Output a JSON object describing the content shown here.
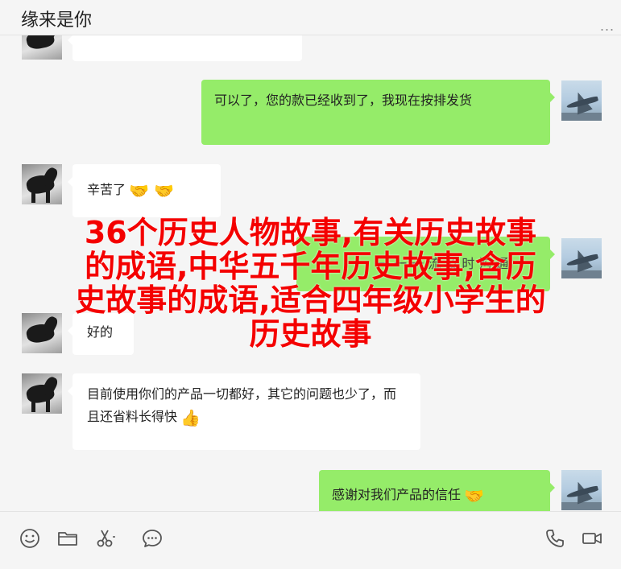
{
  "window": {
    "title": "缘来是你",
    "more_label": "..."
  },
  "messages": [
    {
      "side": "right",
      "text": "可以了，您的款已经收到了，我现在按排发货",
      "emoji": ""
    },
    {
      "side": "left",
      "text": "辛苦了",
      "emoji": "🤝 🤝"
    },
    {
      "side": "right",
      "text": "一 一 一 流 及 时 沟 通",
      "emoji": ""
    },
    {
      "side": "left",
      "text": "好的",
      "emoji": ""
    },
    {
      "side": "left",
      "text": "目前使用你们的产品一切都好，其它的问题也少了，而且还省料长得快",
      "emoji": "👍"
    },
    {
      "side": "right",
      "text": "感谢对我们产品的信任",
      "emoji": "🤝"
    }
  ],
  "overlay": {
    "lines": [
      "36个历史人物故事,有关历史故事",
      "的成语,中华五千年历史故事,含历",
      "史故事的成语,适合四年级小学生的",
      "历史故事"
    ],
    "color": "#f40000"
  },
  "toolbar": {
    "icons": [
      "emoji-icon",
      "folder-icon",
      "scissors-icon",
      "chat-icon",
      "phone-icon",
      "video-icon"
    ]
  },
  "colors": {
    "sent_bubble": "#95ec69",
    "received_bubble": "#ffffff",
    "background": "#f5f5f5"
  }
}
